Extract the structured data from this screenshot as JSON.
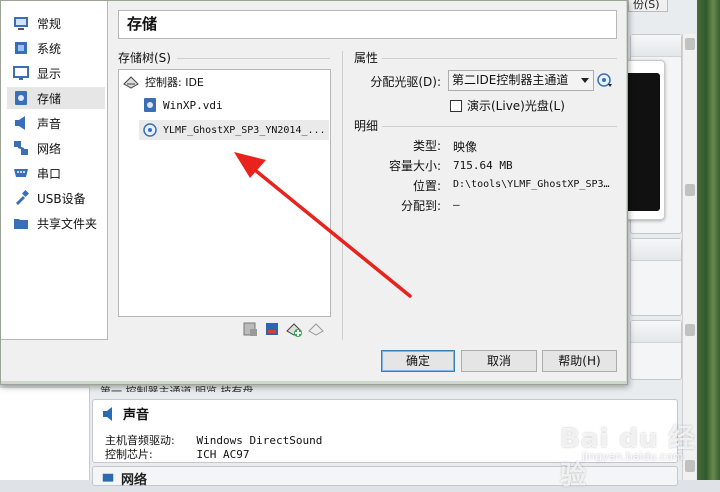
{
  "background": {
    "top_button_label": "份(S)",
    "cut_row_text": "第一   控制器主通道  明览  技有盘",
    "audio": {
      "title": "声音",
      "rows": [
        {
          "key": "主机音频驱动:",
          "value": "Windows DirectSound"
        },
        {
          "key": "控制芯片:",
          "value": "ICH AC97"
        }
      ]
    },
    "network": {
      "title": "网络"
    },
    "watermark": "Bai du 经验",
    "watermark_sub": "jingyan.baidu.com"
  },
  "dialog": {
    "title": "存储",
    "sidebar": {
      "selected_index": 3,
      "items": [
        {
          "label": "常规",
          "icon": "general-icon"
        },
        {
          "label": "系统",
          "icon": "system-icon"
        },
        {
          "label": "显示",
          "icon": "display-icon"
        },
        {
          "label": "存储",
          "icon": "storage-icon"
        },
        {
          "label": "声音",
          "icon": "audio-icon"
        },
        {
          "label": "网络",
          "icon": "network-icon"
        },
        {
          "label": "串口",
          "icon": "serial-port-icon"
        },
        {
          "label": "USB设备",
          "icon": "usb-icon"
        },
        {
          "label": "共享文件夹",
          "icon": "shared-folder-icon"
        }
      ]
    },
    "storage_tree": {
      "label": "存储树(S)",
      "controller": {
        "label": "控制器: IDE",
        "icon": "ide-controller-icon"
      },
      "items": [
        {
          "label": "WinXP.vdi",
          "icon": "hard-disk-icon",
          "selected": false
        },
        {
          "label": "YLMF_GhostXP_SP3_YN2014_...",
          "icon": "optical-disc-icon",
          "selected": true
        }
      ],
      "toolbar": [
        {
          "name": "add-attachment-button",
          "icon": "add-attachment-icon"
        },
        {
          "name": "remove-attachment-button",
          "icon": "remove-attachment-icon"
        },
        {
          "name": "add-controller-button",
          "icon": "add-controller-icon"
        },
        {
          "name": "remove-controller-button",
          "icon": "remove-controller-icon"
        }
      ]
    },
    "attributes": {
      "heading": "属性",
      "drive_label": "分配光驱(D):",
      "drive_value": "第二IDE控制器主通道",
      "live_cd_label": "演示(Live)光盘(L)",
      "live_cd_checked": false
    },
    "details": {
      "heading": "明细",
      "rows": [
        {
          "key": "类型:",
          "value": "映像"
        },
        {
          "key": "容量大小:",
          "value": "715.64  MB"
        },
        {
          "key": "位置:",
          "value": "D:\\tools\\YLMF_GhostXP_SP3…"
        },
        {
          "key": "分配到:",
          "value": "—"
        }
      ]
    },
    "buttons": {
      "ok": "确定",
      "cancel": "取消",
      "help": "帮助(H)"
    }
  },
  "colors": {
    "annotation_arrow": "#e8231e",
    "selection": "#e6e6e6",
    "default_button_border": "#3c7fb1"
  }
}
